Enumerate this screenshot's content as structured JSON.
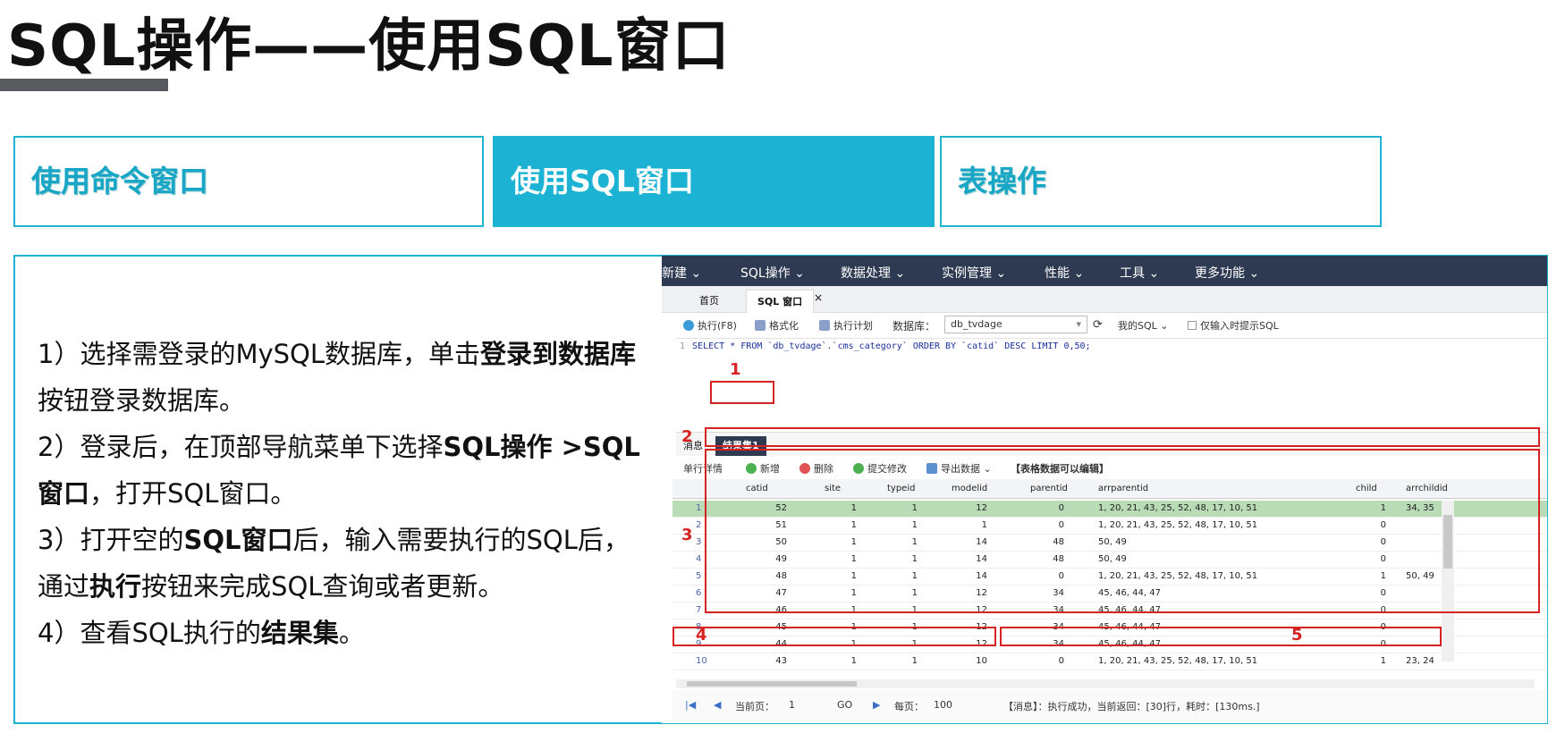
{
  "slide": {
    "title": "SQL操作——使用SQL窗口",
    "tabs": [
      {
        "label": "使用命令窗口"
      },
      {
        "label": "使用SQL窗口"
      },
      {
        "label": "表操作"
      }
    ],
    "steps": [
      {
        "pre": "1）选择需登录的MySQL数据库，单击",
        "b1": "登录到数据库",
        "post": "按钮登录数据库。"
      },
      {
        "pre": "2）登录后，在顶部导航菜单下选择",
        "b1": "SQL操作 >SQL窗口",
        "post": "，打开SQL窗口。"
      },
      {
        "pre": "3）打开空的",
        "b1": "SQL窗口",
        "mid": "后，输入需要执行的SQL后，通过",
        "b2": "执行",
        "post": "按钮来完成SQL查询或者更新。"
      },
      {
        "pre": "4）查看SQL执行的",
        "b1": "结果集",
        "post": "。"
      }
    ]
  },
  "app": {
    "nav": [
      "新建 ⌄",
      "SQL操作 ⌄",
      "数据处理 ⌄",
      "实例管理 ⌄",
      "性能 ⌄",
      "工具 ⌄",
      "更多功能 ⌄"
    ],
    "page_tabs": [
      "首页",
      "SQL 窗口",
      "×"
    ],
    "toolbar": {
      "execute": "执行(F8)",
      "format": "格式化",
      "plan": "执行计划",
      "db_label": "数据库：",
      "db_value": "db_tvdage",
      "refresh": "⟳",
      "my_sql": "我的SQL ⌄",
      "hint": "仅输入时提示SQL"
    },
    "sql": {
      "line": "1",
      "text": "SELECT * FROM `db_tvdage`.`cms_category` ORDER BY `catid` DESC  LIMIT 0,50;"
    },
    "result_tabs": [
      "消息",
      "结果集1"
    ],
    "result_toolbar": {
      "detail": "单行详情",
      "add": "新增",
      "delete": "删除",
      "commit": "提交修改",
      "export": "导出数据 ⌄",
      "note": "【表格数据可以编辑】"
    },
    "columns": [
      "catid",
      "site",
      "typeid",
      "modelid",
      "parentid",
      "arrparentid",
      "child",
      "arrchildid"
    ],
    "rows": [
      [
        "1",
        "52",
        "1",
        "1",
        "12",
        "0",
        "1, 20, 21, 43, 25, 52, 48, 17, 10, 51",
        "1",
        "34, 35"
      ],
      [
        "2",
        "51",
        "1",
        "1",
        "1",
        "0",
        "1, 20, 21, 43, 25, 52, 48, 17, 10, 51",
        "0",
        ""
      ],
      [
        "3",
        "50",
        "1",
        "1",
        "14",
        "48",
        "50, 49",
        "0",
        ""
      ],
      [
        "4",
        "49",
        "1",
        "1",
        "14",
        "48",
        "50, 49",
        "0",
        ""
      ],
      [
        "5",
        "48",
        "1",
        "1",
        "14",
        "0",
        "1, 20, 21, 43, 25, 52, 48, 17, 10, 51",
        "1",
        "50, 49"
      ],
      [
        "6",
        "47",
        "1",
        "1",
        "12",
        "34",
        "45, 46, 44, 47",
        "0",
        ""
      ],
      [
        "7",
        "46",
        "1",
        "1",
        "12",
        "34",
        "45, 46, 44, 47",
        "0",
        ""
      ],
      [
        "8",
        "45",
        "1",
        "1",
        "12",
        "34",
        "45, 46, 44, 47",
        "0",
        ""
      ],
      [
        "9",
        "44",
        "1",
        "1",
        "12",
        "34",
        "45, 46, 44, 47",
        "0",
        ""
      ],
      [
        "10",
        "43",
        "1",
        "1",
        "10",
        "0",
        "1, 20, 21, 43, 25, 52, 48, 17, 10, 51",
        "1",
        "23, 24"
      ]
    ],
    "pager": {
      "first": "|◀",
      "prev": "◀",
      "current_label": "当前页：",
      "current_value": "1",
      "go": "GO",
      "next": "▶",
      "per_page_label": "每页：",
      "per_page_value": "100",
      "message": "【消息】：执行成功，当前返回：[30]行，耗时：[130ms.]"
    },
    "markers": [
      "1",
      "2",
      "3",
      "4",
      "5"
    ]
  },
  "colors": {
    "accent": "#1bb2d4",
    "nav": "#2d3a52",
    "marker": "#d72222",
    "highlight_row": "#b9dcb7"
  }
}
